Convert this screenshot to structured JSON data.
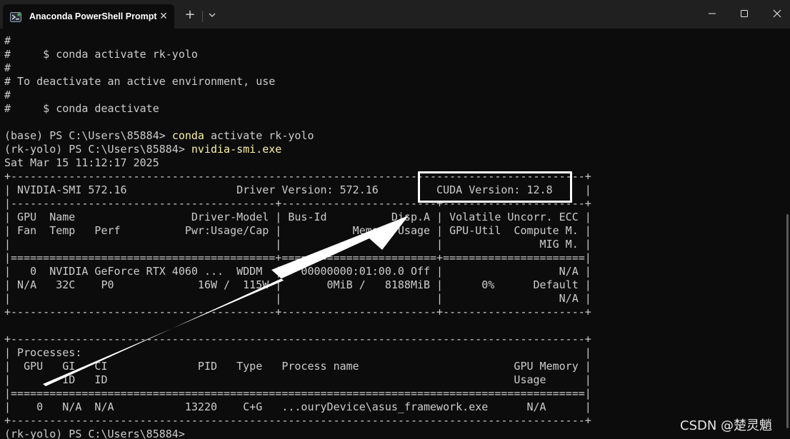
{
  "window": {
    "tab_title": "Anaconda PowerShell Prompt",
    "close_tab_glyph": "✕",
    "new_tab_glyph": "+",
    "icons": {
      "app": "powershell-icon",
      "dropdown": "chevron-down-icon",
      "minimize": "minimize-icon",
      "maximize": "maximize-icon",
      "close": "close-icon"
    }
  },
  "terminal": {
    "lines": [
      {
        "text": "#"
      },
      {
        "text": "#     $ conda activate rk-yolo"
      },
      {
        "text": "#"
      },
      {
        "text": "# To deactivate an active environment, use"
      },
      {
        "text": "#"
      },
      {
        "text": "#     $ conda deactivate"
      },
      {
        "text": ""
      },
      {
        "prompt": "(base) PS C:\\Users\\85884> ",
        "cmd": "conda",
        "rest": " activate rk-yolo"
      },
      {
        "prompt": "(rk-yolo) PS C:\\Users\\85884> ",
        "cmd": "nvidia-smi.exe",
        "rest": ""
      },
      {
        "text": "Sat Mar 15 11:12:17 2025"
      },
      {
        "text": "+-----------------------------------------------------------------------------------------+"
      },
      {
        "text": "| NVIDIA-SMI 572.16                 Driver Version: 572.16         CUDA Version: 12.8     |"
      },
      {
        "text": "|-----------------------------------------+------------------------+----------------------+"
      },
      {
        "text": "| GPU  Name                  Driver-Model | Bus-Id          Disp.A | Volatile Uncorr. ECC |"
      },
      {
        "text": "| Fan  Temp   Perf          Pwr:Usage/Cap |           Memory-Usage | GPU-Util  Compute M. |"
      },
      {
        "text": "|                                         |                        |               MIG M. |"
      },
      {
        "text": "|=========================================+========================+======================|"
      },
      {
        "text": "|   0  NVIDIA GeForce RTX 4060 ...  WDDM  |   00000000:01:00.0 Off |                  N/A |"
      },
      {
        "text": "| N/A   32C    P0             16W /  115W |       0MiB /   8188MiB |      0%      Default |"
      },
      {
        "text": "|                                         |                        |                  N/A |"
      },
      {
        "text": "+-----------------------------------------+------------------------+----------------------+"
      },
      {
        "text": ""
      },
      {
        "text": "+-----------------------------------------------------------------------------------------+"
      },
      {
        "text": "| Processes:                                                                              |"
      },
      {
        "text": "|  GPU   GI   CI              PID   Type   Process name                        GPU Memory |"
      },
      {
        "text": "|        ID   ID                                                               Usage      |"
      },
      {
        "text": "|=========================================================================================|"
      },
      {
        "text": "|    0   N/A  N/A           13220    C+G   ...ouryDevice\\asus_framework.exe      N/A      |"
      },
      {
        "text": "+-----------------------------------------------------------------------------------------+"
      },
      {
        "prompt": "(rk-yolo) PS C:\\Users\\85884>",
        "cmd": "",
        "rest": ""
      }
    ]
  },
  "watermark": "CSDN @楚灵魈",
  "colors": {
    "background": "#0c0c0c",
    "titlebar": "#202020",
    "text": "#cccccc",
    "command": "#f9f1a5",
    "annotation": "#ffffff"
  }
}
